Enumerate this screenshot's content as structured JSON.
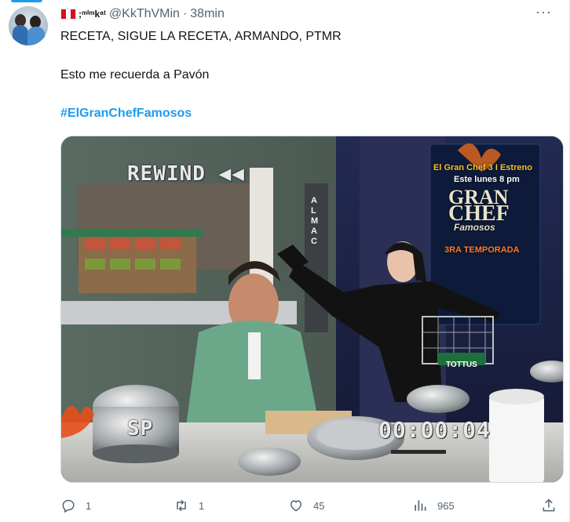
{
  "tweet": {
    "display_name": ";ᵐⁱᵐkᵃᵗ",
    "handle": "@KkThVMin",
    "separator": "·",
    "time": "38min",
    "lines": [
      "RECETA, SIGUE LA RECETA, ARMANDO, PTMR",
      "Esto me recuerda a Pavón"
    ],
    "hashtag": "#ElGranChefFamosos"
  },
  "media": {
    "osd_rewind": "REWIND ◀◀",
    "osd_mode": "SP",
    "osd_timer": "00:00:04",
    "promo_line1": "El Gran Chef 3 I Estreno",
    "promo_line2": "Este lunes 8 pm",
    "brand_line1": "GRAN",
    "brand_line2": "CHEF",
    "brand_line3": "Famosos",
    "brand_line4": "3RA TEMPORADA",
    "store_sign": "TOTTUS",
    "alma_sign": "ALMAC"
  },
  "actions": {
    "reply_count": "1",
    "retweet_count": "1",
    "like_count": "45",
    "view_count": "965"
  },
  "colors": {
    "accent": "#1d9bf0",
    "muted": "#536471",
    "text": "#0f1419"
  },
  "icons": [
    "more-icon",
    "reply-icon",
    "retweet-icon",
    "like-icon",
    "views-icon",
    "share-icon"
  ]
}
